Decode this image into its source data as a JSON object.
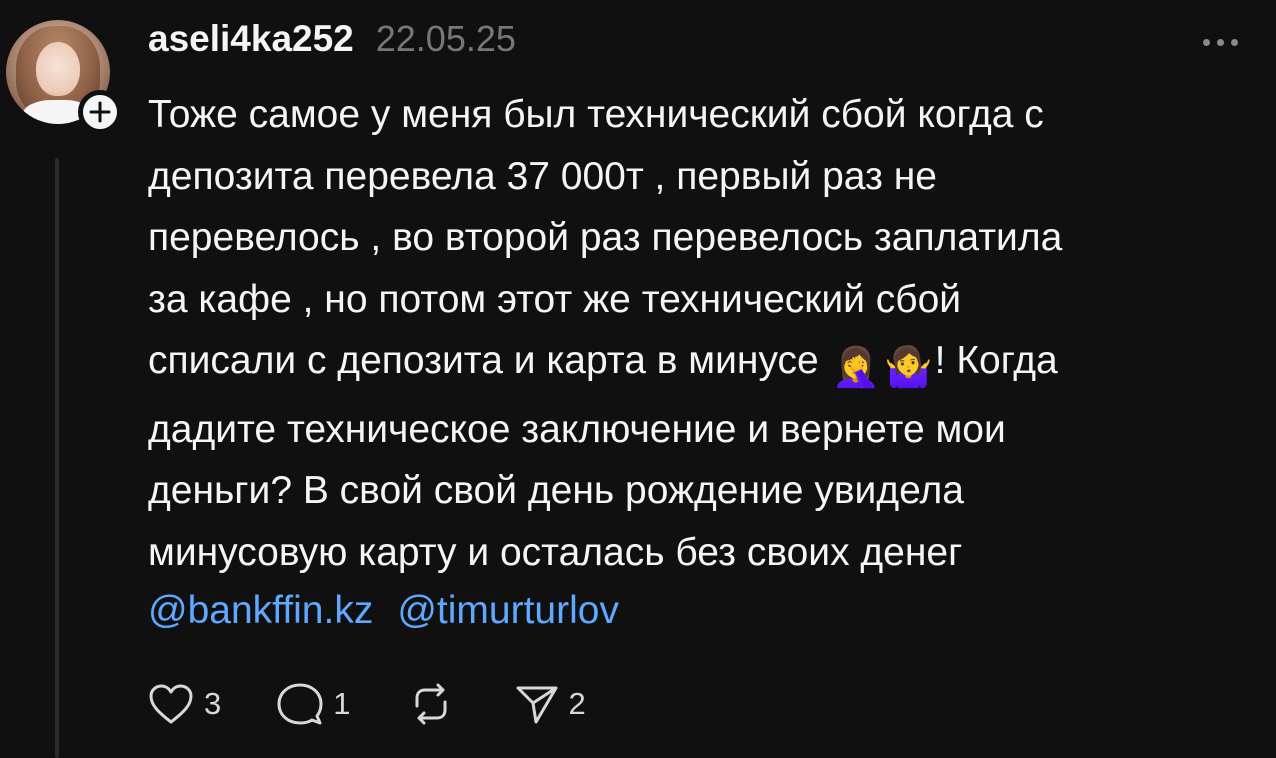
{
  "post": {
    "author": {
      "username": "aseli4ka252",
      "avatar_icon": "user-avatar-photo",
      "follow_icon": "plus-icon"
    },
    "date": "22.05.25",
    "more_icon": "more-horizontal-icon",
    "text_lines": [
      "Тоже самое у меня был технический сбой когда с",
      "депозита перевела 37 000т , первый раз не",
      "перевелось , во второй раз перевелось заплатила",
      "за кафе , но потом этот же технический сбой",
      "списали с депозита и карта в минусе",
      "! Когда",
      "дадите техническое заключение и вернете мои",
      "деньги? В свой свой день рождение увидела",
      "минусовую карту и осталась без своих денег"
    ],
    "emojis": [
      "🤦‍♀️",
      "🤷‍♀️"
    ],
    "mentions": [
      "@bankffin.kz",
      "@timurturlov"
    ],
    "actions": {
      "like": {
        "icon": "heart-icon",
        "count": "3"
      },
      "reply": {
        "icon": "comment-icon",
        "count": "1"
      },
      "repost": {
        "icon": "repost-icon"
      },
      "share": {
        "icon": "send-icon",
        "count": "2"
      }
    },
    "colors": {
      "background": "#101010",
      "text": "#f3f5f7",
      "muted": "#777777",
      "mention": "#5fa8ff"
    }
  }
}
